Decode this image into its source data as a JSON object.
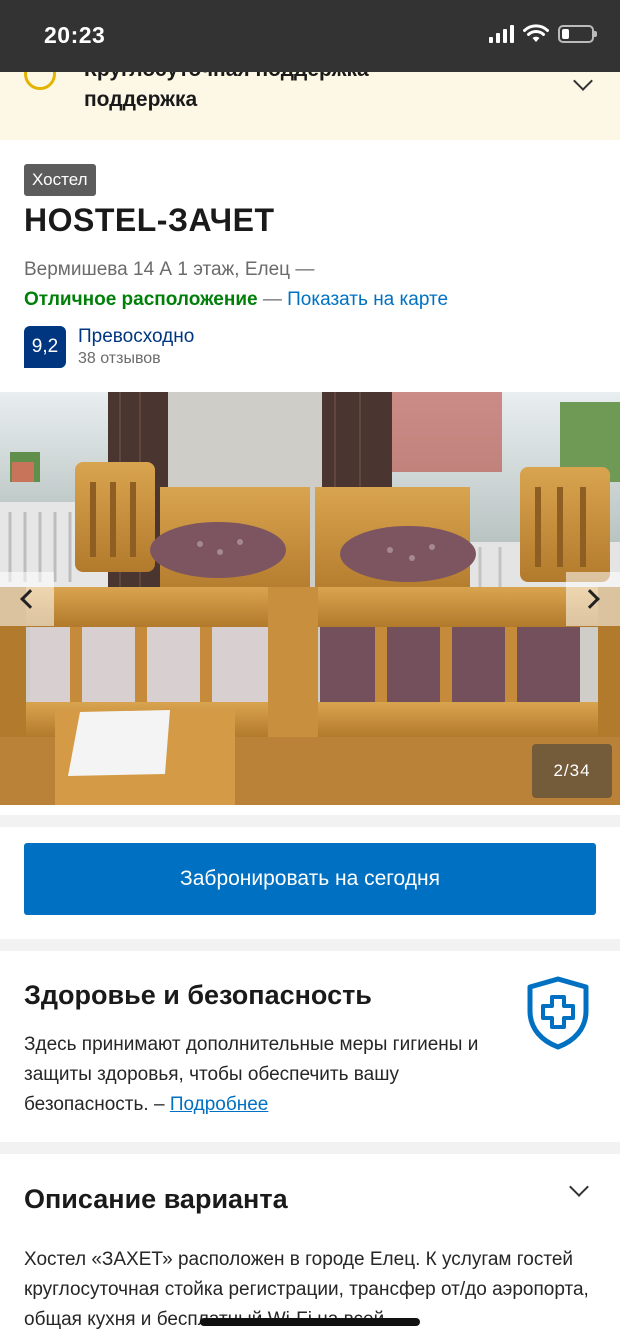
{
  "status_bar": {
    "time": "20:23",
    "icons": [
      "signal-icon",
      "wifi-icon",
      "battery-icon"
    ],
    "battery_level": 0.25
  },
  "notice": {
    "line1": "Круглосуточная поддержка",
    "line2": "поддержка",
    "icon": "info-icon",
    "accent_color": "#e3b400"
  },
  "property": {
    "type_badge": "Хостел",
    "name": "HOSTEL-ЗАЧЕТ",
    "address": "Вермишева 14 А 1 этаж, Елец —",
    "location_rating": "Отличное расположение",
    "location_separator": " — ",
    "show_on_map": "Показать на карте",
    "score": "9,2",
    "score_word": "Превосходно",
    "reviews": "38 отзывов"
  },
  "gallery": {
    "counter": "2/34",
    "prev_icon": "chevron-left-icon",
    "next_icon": "chevron-right-icon"
  },
  "book": {
    "label": "Забронировать на сегодня",
    "color": "#0071c2"
  },
  "health": {
    "title": "Здоровье и безопасность",
    "text": "Здесь принимают дополнительные меры гигиены и защиты здоровья, чтобы обеспечить вашу безопасность. – ",
    "link": "Подробнее",
    "icon": "shield-plus-icon"
  },
  "description": {
    "title": "Описание варианта",
    "text": "Хостел «ЗАХЕТ» расположен в городе Елец. К услугам гостей круглосуточная стойка регистрации, трансфер от/до аэропорта, общая кухня и бесплатный Wi-Fi на всей"
  },
  "colors": {
    "brand_dark": "#003580",
    "brand_blue": "#0071c2",
    "good_green": "#008009",
    "status_bar": "#333333"
  }
}
